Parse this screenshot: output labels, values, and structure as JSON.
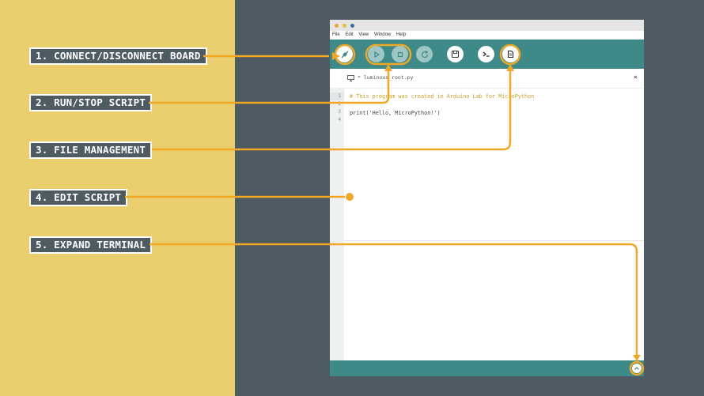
{
  "labels": {
    "connect": "1. CONNECT/DISCONNECT BOARD",
    "run_stop": "2. RUN/STOP SCRIPT",
    "file_mgmt": "3. FILE MANAGEMENT",
    "edit": "4. EDIT SCRIPT",
    "expand": "5. EXPAND TERMINAL"
  },
  "menu": [
    "File",
    "Edit",
    "View",
    "Window",
    "Help"
  ],
  "tab": {
    "title": "* luminous_root.py",
    "close": "×"
  },
  "editor": {
    "line_numbers": [
      "1",
      "2",
      "3",
      "4"
    ],
    "lines": [
      "# This program was created in Arduino Lab for MicroPython",
      "",
      "print('Hello, MicroPython!')",
      ""
    ]
  },
  "colors": {
    "accent_yellow": "#EBCE6E",
    "dark_bg": "#4E5B62",
    "teal": "#3E8A88",
    "highlight_orange": "#F2A824",
    "comment": "#C9A227"
  }
}
